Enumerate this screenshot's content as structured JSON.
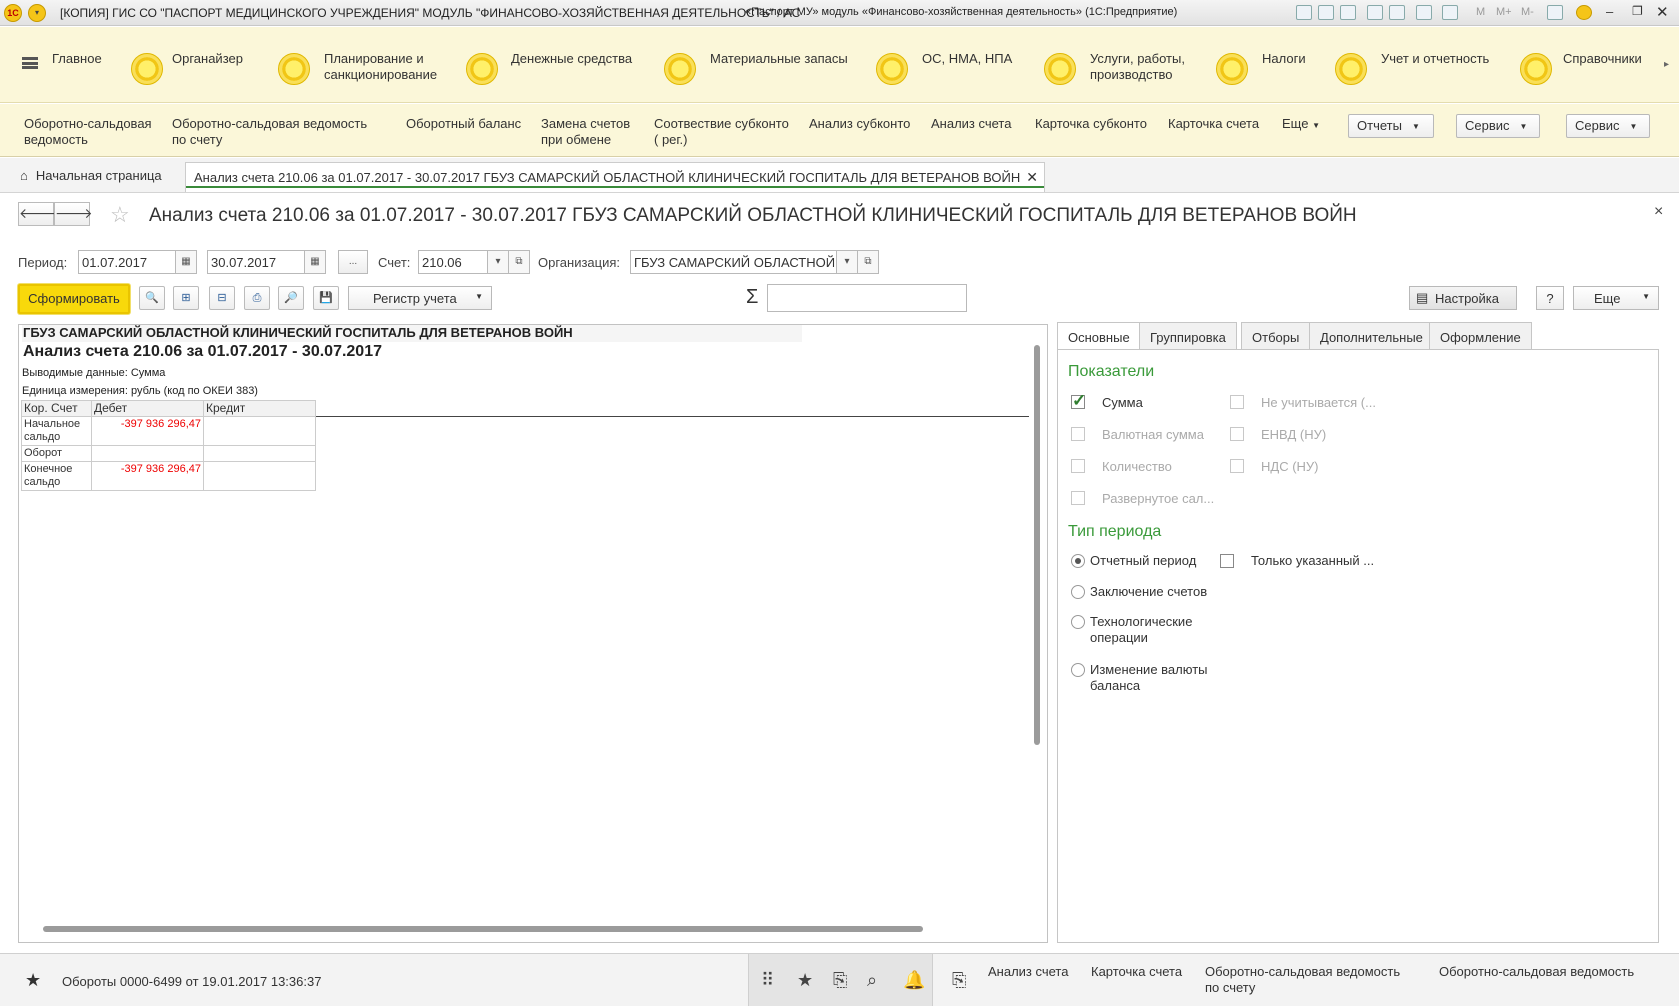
{
  "titlebar": {
    "logo": "1С",
    "title": "[КОПИЯ] ГИС СО \"ПАСПОРТ МЕДИЦИНСКОГО УЧРЕЖДЕНИЯ\" МОДУЛЬ \"ФИНАНСОВО-ХОЗЯЙСТВЕННАЯ ДЕЯТЕЛЬНОСТЬ\" / АС «Паспорт МУ» модуль «Финансово-хозяйственная деятельность» (1С:Предприятие)",
    "title_a": "[КОПИЯ] ГИС СО \"ПАСПОРТ МЕДИЦИНСКОГО УЧРЕЖДЕНИЯ\" МОДУЛЬ \"ФИНАНСОВО-ХОЗЯЙСТВЕННАЯ ДЕЯТЕЛЬНОСТЬ\" / АС",
    "title_b": "«Паспорт МУ» модуль «Финансово-хозяйственная деятельность» (1С:Предприятие)",
    "m_labels": [
      "M",
      "M+",
      "M-"
    ]
  },
  "sections": [
    {
      "label": "Главное"
    },
    {
      "label": "Органайзер"
    },
    {
      "label": "Планирование и санкционирование"
    },
    {
      "label": "Денежные средства"
    },
    {
      "label": "Материальные запасы"
    },
    {
      "label": "ОС, НМА, НПА"
    },
    {
      "label": "Услуги, работы, производство"
    },
    {
      "label": "Налоги"
    },
    {
      "label": "Учет и отчетность"
    },
    {
      "label": "Справочники"
    }
  ],
  "functions": [
    "Оборотно-сальдовая ведомость",
    "Оборотно-сальдовая ведомость по счету",
    "Оборотный баланс",
    "Замена счетов при обмене",
    "Соотвествие субконто ( рег.)",
    "Анализ субконто",
    "Анализ счета",
    "Карточка субконто",
    "Карточка счета",
    "Еще"
  ],
  "function_buttons": [
    "Отчеты",
    "Сервис",
    "Сервис"
  ],
  "tabs": {
    "home": "Начальная страница",
    "active": "Анализ счета 210.06 за 01.07.2017 - 30.07.2017 ГБУЗ САМАРСКИЙ ОБЛАСТНОЙ КЛИНИЧЕСКИЙ ГОСПИТАЛЬ ДЛЯ ВЕТЕРАНОВ ВОЙН"
  },
  "form": {
    "title": "Анализ счета 210.06 за 01.07.2017 - 30.07.2017 ГБУЗ САМАРСКИЙ ОБЛАСТНОЙ КЛИНИЧЕСКИЙ ГОСПИТАЛЬ ДЛЯ ВЕТЕРАНОВ ВОЙН",
    "period_label": "Период:",
    "date_from": "01.07.2017",
    "date_to": "30.07.2017",
    "ellipsis": "...",
    "account_label": "Счет:",
    "account": "210.06",
    "org_label": "Организация:",
    "org": "ГБУЗ САМАРСКИЙ ОБЛАСТНОЙ",
    "generate": "Сформировать",
    "register": "Регистр учета",
    "sigma": "Σ",
    "sum_value": "",
    "settings_btn": "Настройка",
    "help": "?",
    "more": "Еще",
    "close": "×"
  },
  "report": {
    "org": "ГБУЗ САМАРСКИЙ ОБЛАСТНОЙ КЛИНИЧЕСКИЙ ГОСПИТАЛЬ ДЛЯ ВЕТЕРАНОВ ВОЙН",
    "title": "Анализ счета 210.06 за 01.07.2017 - 30.07.2017",
    "output": "Выводимые данные:  Сумма",
    "unit": "Единица измерения: рубль (код по ОКЕИ 383)",
    "columns": [
      "Кор. Счет",
      "Дебет",
      "Кредит"
    ],
    "rows": [
      {
        "label": "Начальное сальдо",
        "debit": "-397 936 296,47",
        "credit": ""
      },
      {
        "label": "Оборот",
        "debit": "",
        "credit": ""
      },
      {
        "label": "Конечное сальдо",
        "debit": "-397 936 296,47",
        "credit": ""
      }
    ]
  },
  "settings": {
    "tabs": [
      "Основные",
      "Группировка",
      "Отборы",
      "Дополнительные",
      "Оформление"
    ],
    "indicators_title": "Показатели",
    "indicators": [
      {
        "label": "Сумма",
        "checked": true,
        "enabled": true
      },
      {
        "label": "Не учитывается (...",
        "checked": false,
        "enabled": false
      },
      {
        "label": "Валютная сумма",
        "checked": false,
        "enabled": false
      },
      {
        "label": "ЕНВД (НУ)",
        "checked": false,
        "enabled": false
      },
      {
        "label": "Количество",
        "checked": false,
        "enabled": false
      },
      {
        "label": "НДС (НУ)",
        "checked": false,
        "enabled": false
      },
      {
        "label": "Развернутое сал...",
        "checked": false,
        "enabled": false
      }
    ],
    "period_type_title": "Тип периода",
    "period_types": [
      "Отчетный период",
      "Заключение счетов",
      "Технологические операции",
      "Изменение валюты баланса"
    ],
    "only_specified": "Только указанный ..."
  },
  "bottom": {
    "history": "Обороты 0000-6499 от 19.01.2017 13:36:37",
    "links": [
      "Анализ счета",
      "Карточка счета",
      "Оборотно-сальдовая ведомость по счету",
      "Оборотно-сальдовая ведомость"
    ]
  },
  "colors": {
    "accent_yellow": "#f8d90b",
    "panel_bg": "#fbf7d9",
    "green_heading": "#3a9a3a",
    "negative": "#e00000"
  }
}
